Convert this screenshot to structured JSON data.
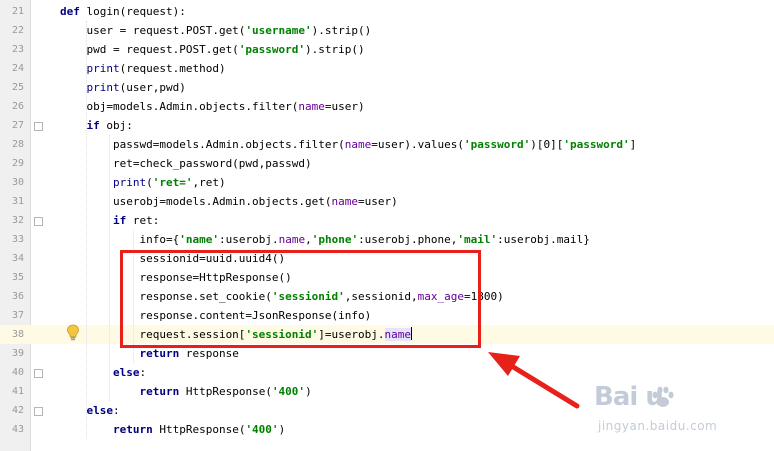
{
  "editor": {
    "lines": [
      {
        "no": "21",
        "tokens": [
          {
            "t": "def ",
            "c": "kw"
          },
          {
            "t": "login(request):"
          }
        ]
      },
      {
        "no": "22",
        "tokens": [
          {
            "t": "    user = request.POST.get("
          },
          {
            "t": "'username'",
            "c": "str"
          },
          {
            "t": ").strip()"
          }
        ]
      },
      {
        "no": "23",
        "tokens": [
          {
            "t": "    pwd = request.POST.get("
          },
          {
            "t": "'password'",
            "c": "str"
          },
          {
            "t": ").strip()"
          }
        ]
      },
      {
        "no": "24",
        "tokens": [
          {
            "t": "    "
          },
          {
            "t": "print",
            "c": "bi"
          },
          {
            "t": "(request.method)"
          }
        ]
      },
      {
        "no": "25",
        "tokens": [
          {
            "t": "    "
          },
          {
            "t": "print",
            "c": "bi"
          },
          {
            "t": "(user,pwd)"
          }
        ]
      },
      {
        "no": "26",
        "tokens": [
          {
            "t": "    obj=models.Admin.objects.filter("
          },
          {
            "t": "name",
            "c": "kwa"
          },
          {
            "t": "=user)"
          }
        ]
      },
      {
        "no": "27",
        "tokens": [
          {
            "t": "    "
          },
          {
            "t": "if ",
            "c": "kw"
          },
          {
            "t": "obj:"
          }
        ]
      },
      {
        "no": "28",
        "tokens": [
          {
            "t": "        passwd=models.Admin.objects.filter("
          },
          {
            "t": "name",
            "c": "kwa"
          },
          {
            "t": "=user).values("
          },
          {
            "t": "'password'",
            "c": "str"
          },
          {
            "t": ")[0]["
          },
          {
            "t": "'password'",
            "c": "str"
          },
          {
            "t": "]"
          }
        ]
      },
      {
        "no": "29",
        "tokens": [
          {
            "t": "        ret=check_password(pwd,passwd)"
          }
        ]
      },
      {
        "no": "30",
        "tokens": [
          {
            "t": "        "
          },
          {
            "t": "print",
            "c": "bi"
          },
          {
            "t": "("
          },
          {
            "t": "'ret='",
            "c": "str"
          },
          {
            "t": ",ret)"
          }
        ]
      },
      {
        "no": "31",
        "tokens": [
          {
            "t": "        userobj=models.Admin.objects.get("
          },
          {
            "t": "name",
            "c": "kwa"
          },
          {
            "t": "=user)"
          }
        ]
      },
      {
        "no": "32",
        "tokens": [
          {
            "t": "        "
          },
          {
            "t": "if ",
            "c": "kw"
          },
          {
            "t": "ret:"
          }
        ]
      },
      {
        "no": "33",
        "tokens": [
          {
            "t": "            info={"
          },
          {
            "t": "'name'",
            "c": "str"
          },
          {
            "t": ":userobj."
          },
          {
            "t": "name",
            "c": "attr"
          },
          {
            "t": ","
          },
          {
            "t": "'phone'",
            "c": "str"
          },
          {
            "t": ":userobj.phone,"
          },
          {
            "t": "'mail'",
            "c": "str"
          },
          {
            "t": ":userobj.mail}"
          }
        ]
      },
      {
        "no": "34",
        "tokens": [
          {
            "t": "            sessionid=uuid.uuid4()"
          }
        ]
      },
      {
        "no": "35",
        "tokens": [
          {
            "t": "            response=HttpResponse()"
          }
        ]
      },
      {
        "no": "36",
        "tokens": [
          {
            "t": "            response.set_cookie("
          },
          {
            "t": "'sessionid'",
            "c": "str"
          },
          {
            "t": ",sessionid,"
          },
          {
            "t": "max_age",
            "c": "kwa"
          },
          {
            "t": "=1800)"
          }
        ]
      },
      {
        "no": "37",
        "tokens": [
          {
            "t": "            response.content=JsonResponse(info)"
          }
        ]
      },
      {
        "no": "38",
        "tokens": [
          {
            "t": "            request.session["
          },
          {
            "t": "'sessionid'",
            "c": "str"
          },
          {
            "t": "]=userobj."
          },
          {
            "t": "name",
            "c": "attr hl-word"
          }
        ],
        "current": true
      },
      {
        "no": "39",
        "tokens": [
          {
            "t": "            "
          },
          {
            "t": "return ",
            "c": "kw"
          },
          {
            "t": "response"
          }
        ]
      },
      {
        "no": "40",
        "tokens": [
          {
            "t": "        "
          },
          {
            "t": "else",
            "c": "kw"
          },
          {
            "t": ":"
          }
        ]
      },
      {
        "no": "41",
        "tokens": [
          {
            "t": "            "
          },
          {
            "t": "return ",
            "c": "kw"
          },
          {
            "t": "HttpResponse("
          },
          {
            "t": "'400'",
            "c": "str"
          },
          {
            "t": ")"
          }
        ]
      },
      {
        "no": "42",
        "tokens": [
          {
            "t": "    "
          },
          {
            "t": "else",
            "c": "kw"
          },
          {
            "t": ":"
          }
        ]
      },
      {
        "no": "43",
        "tokens": [
          {
            "t": "        "
          },
          {
            "t": "return ",
            "c": "kw"
          },
          {
            "t": "HttpResponse("
          },
          {
            "t": "'400'",
            "c": "str"
          },
          {
            "t": ")"
          }
        ]
      }
    ]
  },
  "colors": {
    "keyword": "#000080",
    "string": "#008000",
    "kwarg": "#660099",
    "annotation": "#e8201a"
  },
  "watermark": {
    "brand": "Bai  u",
    "subtitle": "jingyan.baidu.com",
    "icon": "paw-icon"
  },
  "icons": {
    "intention": "lightbulb-icon",
    "annotation_arrow": "red-arrow-icon"
  }
}
